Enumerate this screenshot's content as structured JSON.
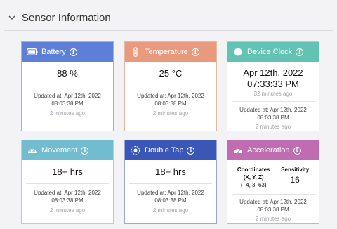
{
  "section": {
    "title": "Sensor Information"
  },
  "cards": [
    {
      "title": "Battery",
      "value": "88 %",
      "updated": "Updated at: Apr 12th, 2022 08:03:38 PM",
      "ago": "2 minutes ago"
    },
    {
      "title": "Temperature",
      "value": "25 °C",
      "updated": "Updated at: Apr 12th, 2022 08:03:38 PM",
      "ago": "2 minutes ago"
    },
    {
      "title": "Device Clock",
      "value": "Apr 12th, 2022 07:33:33 PM",
      "value_ago": "32 minutes ago",
      "updated": "Updated at: Apr 12th, 2022 08:03:38 PM",
      "ago": "2 minutes ago"
    },
    {
      "title": "Movement",
      "value": "18+ hrs",
      "updated": "Updated at: Apr 12th, 2022 08:03:38 PM",
      "ago": "2 minutes ago"
    },
    {
      "title": "Double Tap",
      "value": "18+ hrs",
      "updated": "Updated at: Apr 12th, 2022 08:03:38 PM",
      "ago": "2 minutes ago"
    },
    {
      "title": "Acceleration",
      "coords_label": "Coordinates",
      "coords_axes": "(X, Y, Z)",
      "coords_value": "(−4, 3, 63)",
      "sens_label": "Sensitivity",
      "sens_value": "16",
      "updated": "Updated at: Apr 12th, 2022 08:03:38 PM",
      "ago": "2 minutes ago"
    }
  ],
  "icons": {
    "collapse": "chevron-down-icon",
    "info": "info-icon",
    "battery": "battery-icon",
    "temperature": "thermometer-icon",
    "clock": "clock-icon",
    "movement": "gauge-icon",
    "tap": "tap-icon",
    "acceleration": "speedometer-icon"
  },
  "colors": {
    "battery": "#5e7fd8",
    "temperature": "#e99a7c",
    "clock": "#63c3b2",
    "movement": "#72bccf",
    "tap": "#3a57b8",
    "acceleration": "#c06cb3"
  }
}
